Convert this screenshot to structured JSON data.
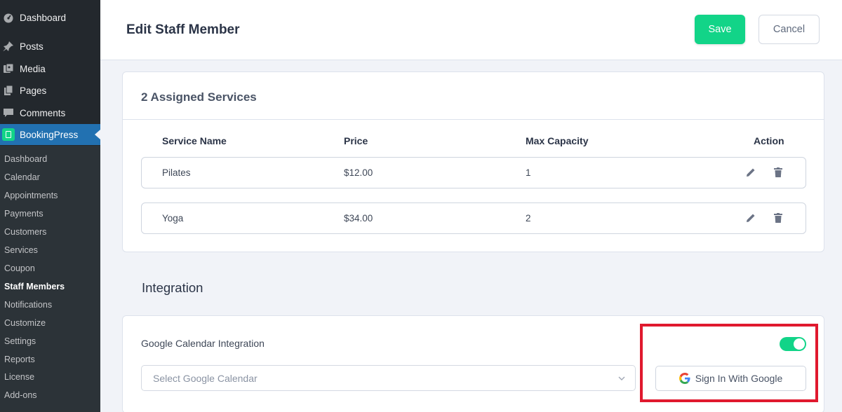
{
  "sidebar": {
    "menu": [
      {
        "label": "Dashboard",
        "icon": "dashboard-icon"
      },
      {
        "label": "Posts",
        "icon": "pin-icon"
      },
      {
        "label": "Media",
        "icon": "media-icon"
      },
      {
        "label": "Pages",
        "icon": "pages-icon"
      },
      {
        "label": "Comments",
        "icon": "comment-icon"
      },
      {
        "label": "BookingPress",
        "icon": "bookingpress-icon"
      }
    ],
    "submenu": [
      "Dashboard",
      "Calendar",
      "Appointments",
      "Payments",
      "Customers",
      "Services",
      "Coupon",
      "Staff Members",
      "Notifications",
      "Customize",
      "Settings",
      "Reports",
      "License",
      "Add-ons"
    ],
    "current_submenu": "Staff Members"
  },
  "header": {
    "title": "Edit Staff Member",
    "save_label": "Save",
    "cancel_label": "Cancel"
  },
  "services": {
    "title": "2 Assigned Services",
    "columns": [
      "Service Name",
      "Price",
      "Max Capacity",
      "Action"
    ],
    "rows": [
      {
        "name": "Pilates",
        "price": "$12.00",
        "capacity": "1"
      },
      {
        "name": "Yoga",
        "price": "$34.00",
        "capacity": "2"
      }
    ]
  },
  "integration": {
    "heading": "Integration",
    "google_calendar_label": "Google Calendar Integration",
    "toggle_on": true,
    "select_placeholder": "Select Google Calendar",
    "sign_in_label": "Sign In With Google"
  },
  "colors": {
    "accent": "#12d488",
    "highlight": "#e0192e",
    "sidebar_bg": "#23282d",
    "active_menu": "#2271b1"
  }
}
